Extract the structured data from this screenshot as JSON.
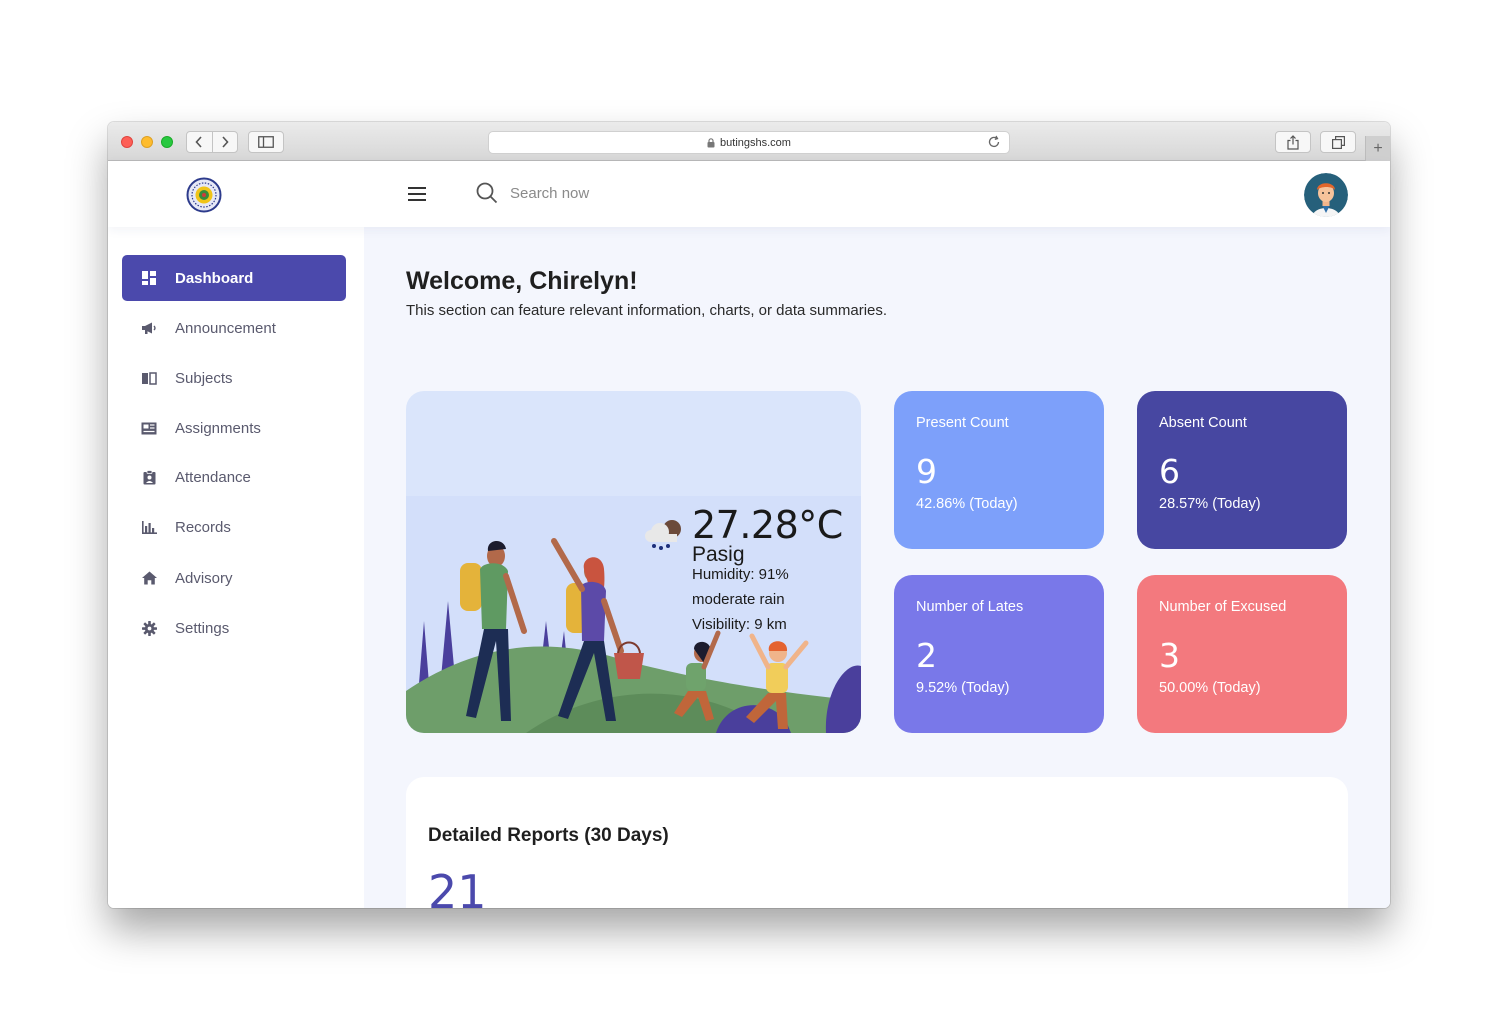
{
  "browser": {
    "url": "butingshs.com"
  },
  "header": {
    "search_placeholder": "Search now"
  },
  "sidebar": {
    "items": [
      {
        "label": "Dashboard",
        "icon": "dashboard-icon",
        "active": true
      },
      {
        "label": "Announcement",
        "icon": "megaphone-icon"
      },
      {
        "label": "Subjects",
        "icon": "book-icon"
      },
      {
        "label": "Assignments",
        "icon": "newspaper-icon"
      },
      {
        "label": "Attendance",
        "icon": "clipboard-icon"
      },
      {
        "label": "Records",
        "icon": "bar-chart-icon"
      },
      {
        "label": "Advisory",
        "icon": "home-icon"
      },
      {
        "label": "Settings",
        "icon": "gear-icon"
      }
    ]
  },
  "main": {
    "welcome": "Welcome, Chirelyn!",
    "subtitle": "This section can feature relevant information, charts, or data summaries.",
    "weather": {
      "temperature": "27.28°C",
      "city": "Pasig",
      "humidity": "Humidity: 91%",
      "description": "moderate rain",
      "visibility": "Visibility: 9 km",
      "icon": "rain-cloud-icon"
    },
    "stats": [
      {
        "title": "Present Count",
        "value": "9",
        "sub": "42.86% (Today)",
        "color": "#7da0fa"
      },
      {
        "title": "Absent Count",
        "value": "6",
        "sub": "28.57% (Today)",
        "color": "#4747a1"
      },
      {
        "title": "Number of Lates",
        "value": "2",
        "sub": "9.52% (Today)",
        "color": "#7978e9"
      },
      {
        "title": "Number of Excused",
        "value": "3",
        "sub": "50.00% (Today)",
        "color": "#f3797e"
      }
    ],
    "report": {
      "title": "Detailed Reports (30 Days)",
      "value": "21"
    }
  },
  "colors": {
    "accent": "#4b49ac",
    "background": "#f4f6fd"
  }
}
